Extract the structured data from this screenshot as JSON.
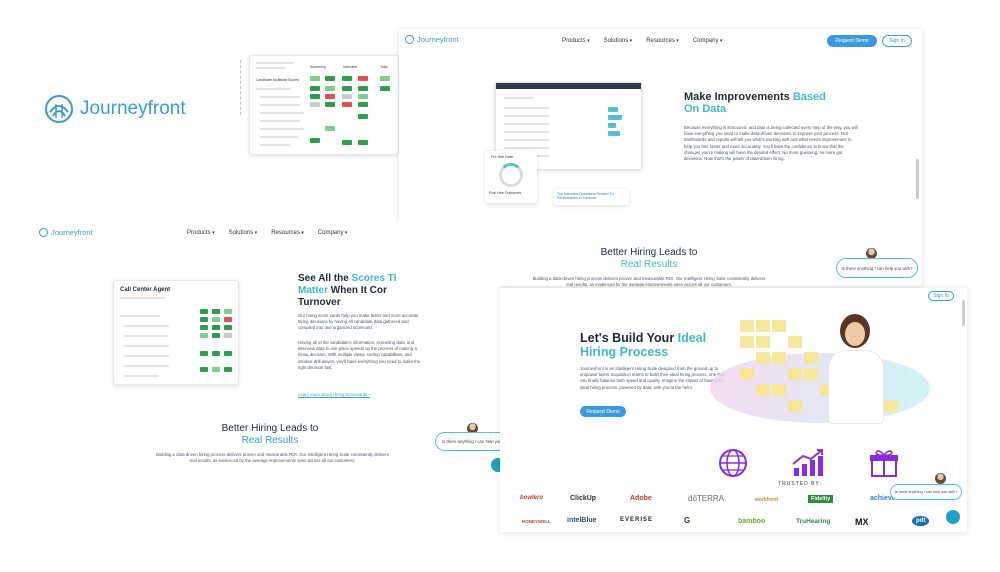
{
  "brand": {
    "name": "Journeyfront",
    "color": "#3a9bdc"
  },
  "nav": {
    "items": [
      "Products",
      "Solutions",
      "Resources",
      "Company"
    ],
    "request_demo": "Request Demo",
    "sign_in": "Sign In"
  },
  "shot_top_right": {
    "title_a": "Make Improvements ",
    "title_b": "Based",
    "title_c": "On Data",
    "body": "Because everything is structured, and data is being collected every step of the way, you will have everything you need to make data-driven decisions to improve your process. Our dashboards and reports will tell you what's working well and what needs improvement to help you hire faster and more accurately. You'll have the confidence to know that the changes you're making will have the desired effect. No more guessing, no more gut decisions. Now that's the power of data-driven hiring.",
    "donut_label": "Pre Hire Data",
    "donut_caption": "Post Hire Outcomes",
    "callout": "Top Interview Questions Related To Performance In Turnover"
  },
  "better_hiring": {
    "title_a": "Better Hiring Leads to",
    "title_b": "Real Results",
    "body": "Building a data-driven hiring process delivers proven and measurable ROI. Our Intelligent Hiring Suite consistently delivers real results, as evidenced by the average improvements seen across all our customers."
  },
  "shot_left": {
    "card_title": "Call Center Agent",
    "title_a": "See All the ",
    "title_b": "Scores Tl",
    "title_c": "Matter",
    "title_d": " When It Cor",
    "title_e": "Turnover",
    "body1": "Our hiring score cards help you make faster and more accurate hiring decisions by having all candidate data gathered and compiled into one organized scorecard.",
    "body2": "Having all of the candidate's information, screening data, and interview data in one place speeds up the process of making a hiring decision. With multiple views, sorting capabilities, and intuitive drill downs, you'll have everything you need to make the right decision fast.",
    "link": "Learn more about Hiring Scorecards ›"
  },
  "shot_bottom_right": {
    "title_a": "Let's Build Your ",
    "title_b": "Ideal",
    "title_c": "Hiring Process",
    "body": "Journeyfront is an Intelligent Hiring Suite designed from the ground up to empower talent acquisition teams to build their ideal hiring process, one that can finally balance both speed and quality. Imagine the impact of having the ideal hiring process, powered by data, with you at the helm.",
    "cta": "Request Demo",
    "trusted": "TRUSTED BY:"
  },
  "logos_row1": [
    "bowlero",
    "ClickUp",
    "Adobe",
    "dōTERRA",
    "workfront",
    "Fidelity",
    "achieve"
  ],
  "logos_row2": [
    "HONEYWELL",
    "intelBlue",
    "EVERISE",
    "G",
    "bamboo",
    "TruHearing",
    "MX",
    "pdt"
  ],
  "chat": {
    "prompt": "Is there anything I can help you with?"
  },
  "table_header": {
    "col1": "Screening",
    "col2": "Interview",
    "col3": "Total",
    "row_head": "Candidate Multitude Scores"
  }
}
